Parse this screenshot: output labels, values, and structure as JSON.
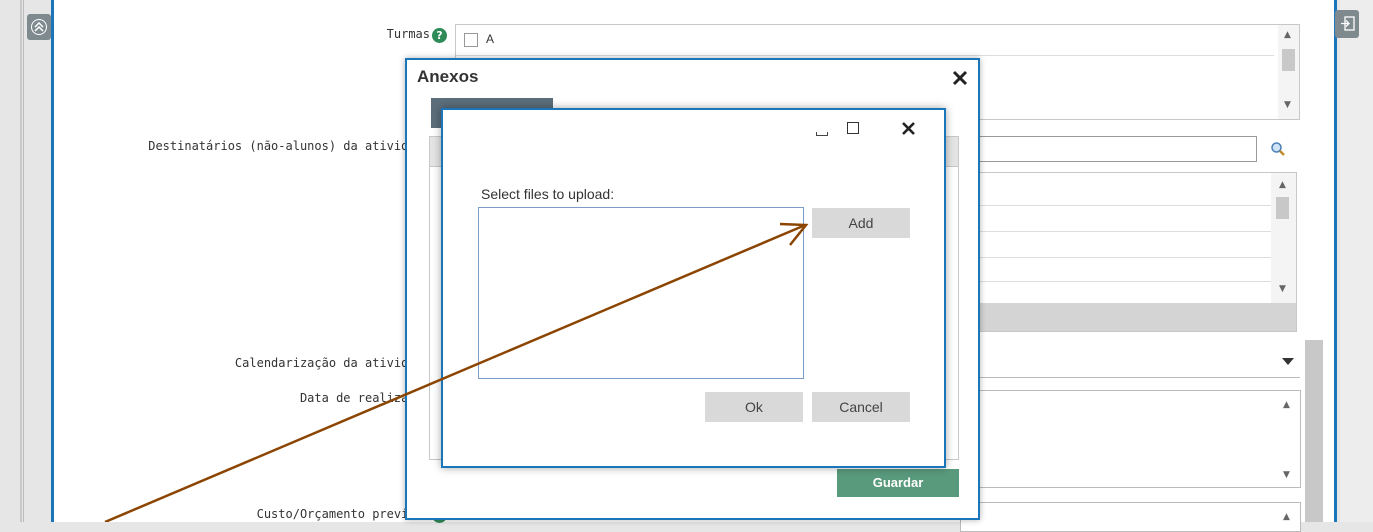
{
  "form": {
    "turmas_label": "Turmas",
    "turmas_option": "A",
    "destinatarios_label": "Destinatários (não-alunos) da atividade",
    "calendarizacao_label": "Calendarização da atividade",
    "data_realizacao_label": "Data de realização",
    "custo_label": "Custo/Orçamento previsto"
  },
  "anexos_dialog": {
    "title": "Anexos",
    "save_label": "Guardar"
  },
  "upload_dialog": {
    "prompt": "Select files to upload:",
    "add_label": "Add",
    "ok_label": "Ok",
    "cancel_label": "Cancel"
  },
  "colors": {
    "accent_blue": "#1b75bb",
    "save_green": "#5a9a7c",
    "help_green": "#2e8b57",
    "annotation_arrow": "#8b4500"
  }
}
